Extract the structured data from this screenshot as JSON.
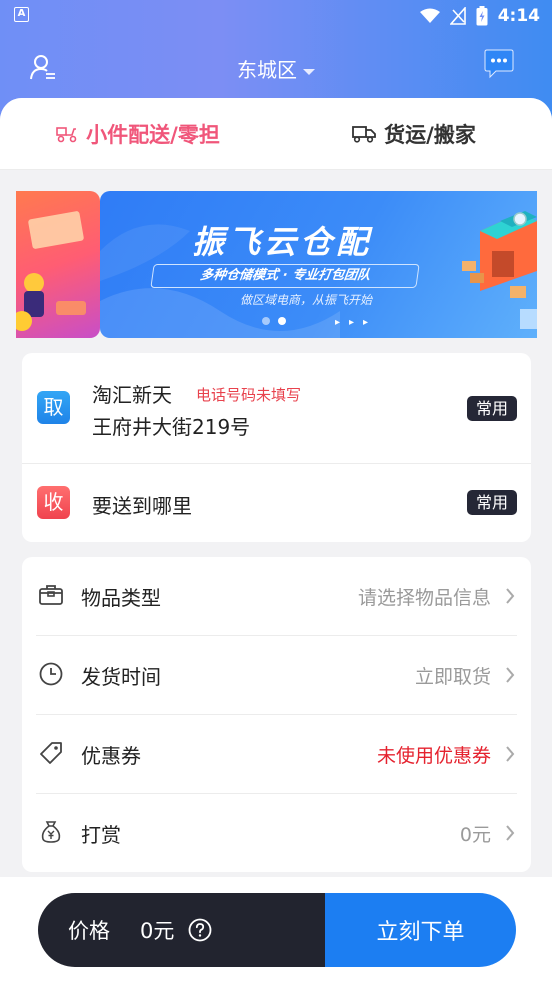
{
  "status_bar": {
    "time": "4:14",
    "app_badge": "A"
  },
  "header": {
    "city": "东城区"
  },
  "tabs": [
    {
      "label": "小件配送/零担",
      "active": true
    },
    {
      "label": "货运/搬家",
      "active": false
    }
  ],
  "banner": {
    "title": "振飞云仓配",
    "tagline": "多种仓储模式 · 专业打包团队",
    "subtitle": "做区域电商，从振飞开始",
    "arrows": "▸▸▸",
    "active_dot": 2,
    "dot_count": 2
  },
  "pickup": {
    "badge": "取",
    "name": "淘汇新天",
    "warning": "电话号码未填写",
    "address": "王府井大街219号",
    "often_label": "常用"
  },
  "delivery": {
    "badge": "收",
    "placeholder": "要送到哪里",
    "often_label": "常用"
  },
  "options": [
    {
      "icon": "box-icon",
      "label": "物品类型",
      "value": "请选择物品信息",
      "value_color": "#9a9a9a"
    },
    {
      "icon": "clock-icon",
      "label": "发货时间",
      "value": "立即取货",
      "value_color": "#9a9a9a"
    },
    {
      "icon": "coupon-tag-icon",
      "label": "优惠券",
      "value": "未使用优惠券",
      "value_color": "#e5222e"
    },
    {
      "icon": "money-bag-icon",
      "label": "打赏",
      "value": "0元",
      "value_color": "#9a9a9a"
    }
  ],
  "footer": {
    "price_label": "价格",
    "price_value": "0元",
    "order_button": "立刻下单"
  },
  "colors": {
    "accent_pink": "#f0567a",
    "primary_blue": "#1c7ef2",
    "dark": "#22242f",
    "warning_red": "#e5222e"
  }
}
